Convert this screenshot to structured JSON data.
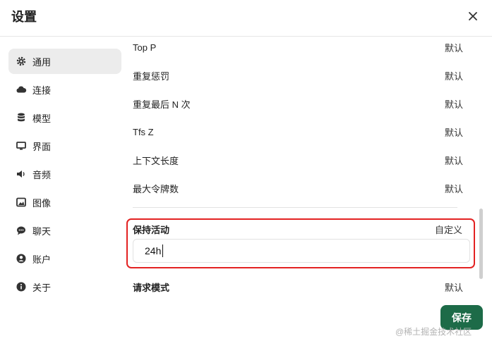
{
  "header": {
    "title": "设置"
  },
  "sidebar": {
    "items": [
      {
        "label": "通用",
        "icon": "gear-icon"
      },
      {
        "label": "连接",
        "icon": "cloud-icon"
      },
      {
        "label": "模型",
        "icon": "database-icon"
      },
      {
        "label": "界面",
        "icon": "monitor-icon"
      },
      {
        "label": "音频",
        "icon": "speaker-icon"
      },
      {
        "label": "图像",
        "icon": "image-icon"
      },
      {
        "label": "聊天",
        "icon": "chat-icon"
      },
      {
        "label": "账户",
        "icon": "user-icon"
      },
      {
        "label": "关于",
        "icon": "info-icon"
      }
    ],
    "active": "通用"
  },
  "params": [
    {
      "label": "Top P",
      "value": "默认"
    },
    {
      "label": "重复惩罚",
      "value": "默认"
    },
    {
      "label": "重复最后 N 次",
      "value": "默认"
    },
    {
      "label": "Tfs Z",
      "value": "默认"
    },
    {
      "label": "上下文长度",
      "value": "默认"
    },
    {
      "label": "最大令牌数",
      "value": "默认"
    }
  ],
  "keep_alive": {
    "label": "保持活动",
    "mode": "自定义",
    "value": "24h"
  },
  "request_mode": {
    "label": "请求模式",
    "value": "默认"
  },
  "save_label": "保存",
  "watermark": "@稀土掘金技术社区",
  "colors": {
    "accent": "#1d6b48",
    "highlight": "#e32222"
  }
}
